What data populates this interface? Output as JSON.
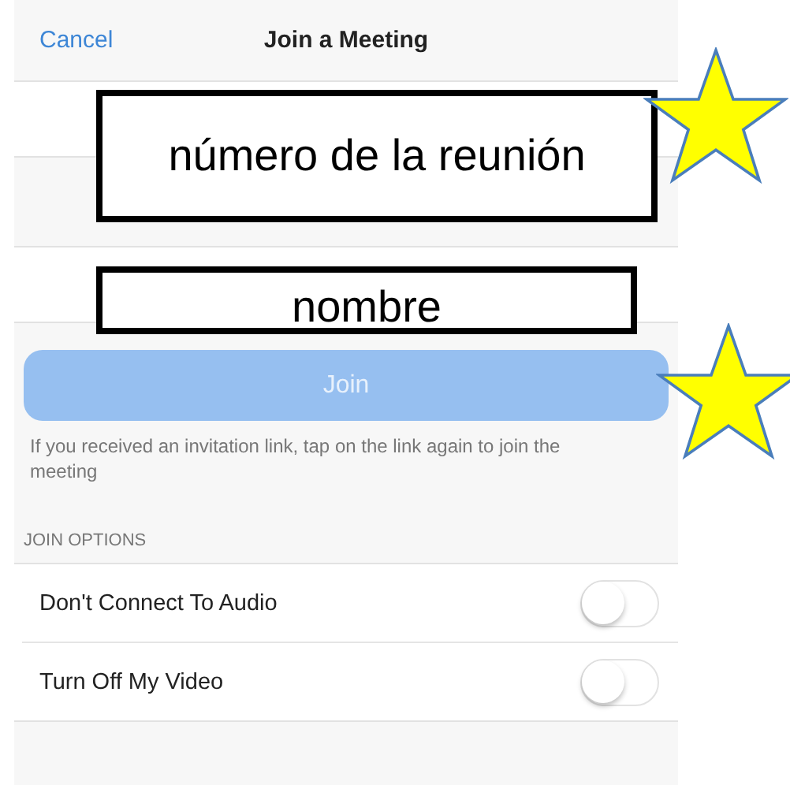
{
  "header": {
    "cancel": "Cancel",
    "title": "Join a Meeting"
  },
  "fields": [
    {
      "annotation": "número de la reunión"
    },
    {
      "annotation": "nombre"
    }
  ],
  "join_button": {
    "label": "Join",
    "disabled": true
  },
  "hint": "If you received an invitation link, tap on the link again to join the meeting",
  "section_title": "JOIN OPTIONS",
  "options": [
    {
      "label": "Don't Connect To Audio",
      "on": false
    },
    {
      "label": "Turn Off My Video",
      "on": false
    }
  ]
}
